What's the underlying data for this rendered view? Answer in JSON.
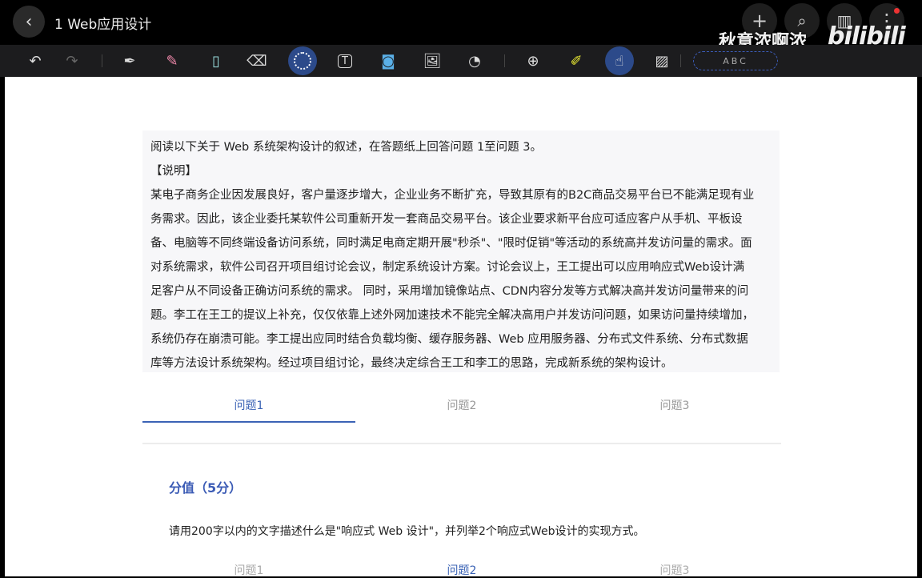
{
  "header": {
    "title": "1 Web应用设计"
  },
  "watermark": {
    "user": "秋意浓啊浓",
    "logo": "bilibili"
  },
  "toolbar": {
    "abc_label": "ABC"
  },
  "description": {
    "lines": [
      "阅读以下关于 Web 系统架构设计的叙述，在答题纸上回答问题 1至问题 3。",
      "【说明】",
      "某电子商务企业因发展良好，客户量逐步增大，企业业务不断扩充，导致其原有的B2C商品交易平台已不能满足现有业",
      "务需求。因此，该企业委托某软件公司重新开发一套商品交易平台。该企业要求新平台应可适应客户从手机、平板设",
      "备、电脑等不同终端设备访问系统，同时满足电商定期开展\"秒杀\"、\"限时促销\"等活动的系统高并发访问量的需求。面",
      "对系统需求，软件公司召开项目组讨论会议，制定系统设计方案。讨论会议上，王工提出可以应用响应式Web设计满",
      "足客户从不同设备正确访问系统的需求。 同时，采用增加镜像站点、CDN内容分发等方式解决高并发访问量带来的问",
      "题。李工在王工的提议上补充，仅仅依靠上述外网加速技术不能完全解决高用户并发访问问题，如果访问量持续增加，",
      "系统仍存在崩溃可能。李工提出应同时结合负载均衡、缓存服务器、Web 应用服务器、分布式文件系统、分布式数据",
      "库等方法设计系统架构。经过项目组讨论，最终决定综合王工和李工的思路，完成新系统的架构设计。"
    ]
  },
  "tabs": [
    "问题1",
    "问题2",
    "问题3"
  ],
  "question": {
    "score": "分值（5分）",
    "text": "请用200字以内的文字描述什么是\"响应式 Web 设计\"，并列举2个响应式Web设计的实现方式。"
  },
  "tabs2": [
    "问题1",
    "问题2",
    "问题3"
  ],
  "colors": {
    "accent": "#3b63b5",
    "toolbar": "#1c1c1e"
  }
}
